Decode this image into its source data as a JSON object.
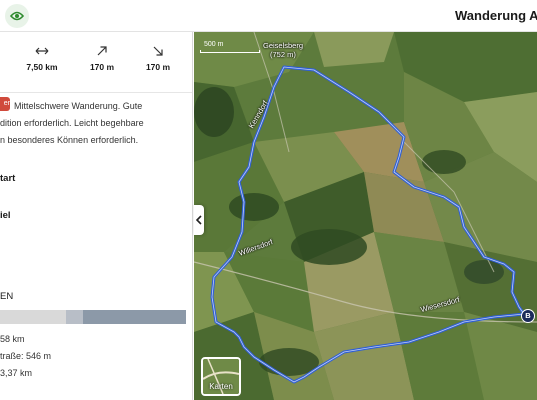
{
  "header": {
    "title": "Wanderung Alte",
    "eye_color": "#2e8b2e"
  },
  "stats": [
    {
      "icon": "distance-arrows-icon",
      "value": "7,50 km"
    },
    {
      "icon": "ascent-arrow-icon",
      "value": "170 m"
    },
    {
      "icon": "descent-arrow-icon",
      "value": "170 m"
    }
  ],
  "difficulty": {
    "badge": "er",
    "line1": "Mittelschwere Wanderung. Gute",
    "line2": "dition erforderlich. Leicht begehbare",
    "line3": "n besonderes Können erforderlich."
  },
  "waypoints": {
    "start": "tart",
    "finish": "iel"
  },
  "section_label": "EN",
  "surface": {
    "colors": [
      "#d9d9d9",
      "#b8bec7",
      "#8c99a8"
    ],
    "line1": "58 km",
    "line2": "traße: 546 m",
    "line3": "3,37 km"
  },
  "map": {
    "scale_label": "500 m",
    "place_label": "Geiselsberg",
    "summit_label": "(752 m)",
    "road_label_1": "Wiesersdorf",
    "road_label_2": "Wiliersdorf",
    "road_label_3": "Kenndorf",
    "layer_button": "Karten",
    "marker": "B",
    "route_color": "#2f5fd6"
  }
}
